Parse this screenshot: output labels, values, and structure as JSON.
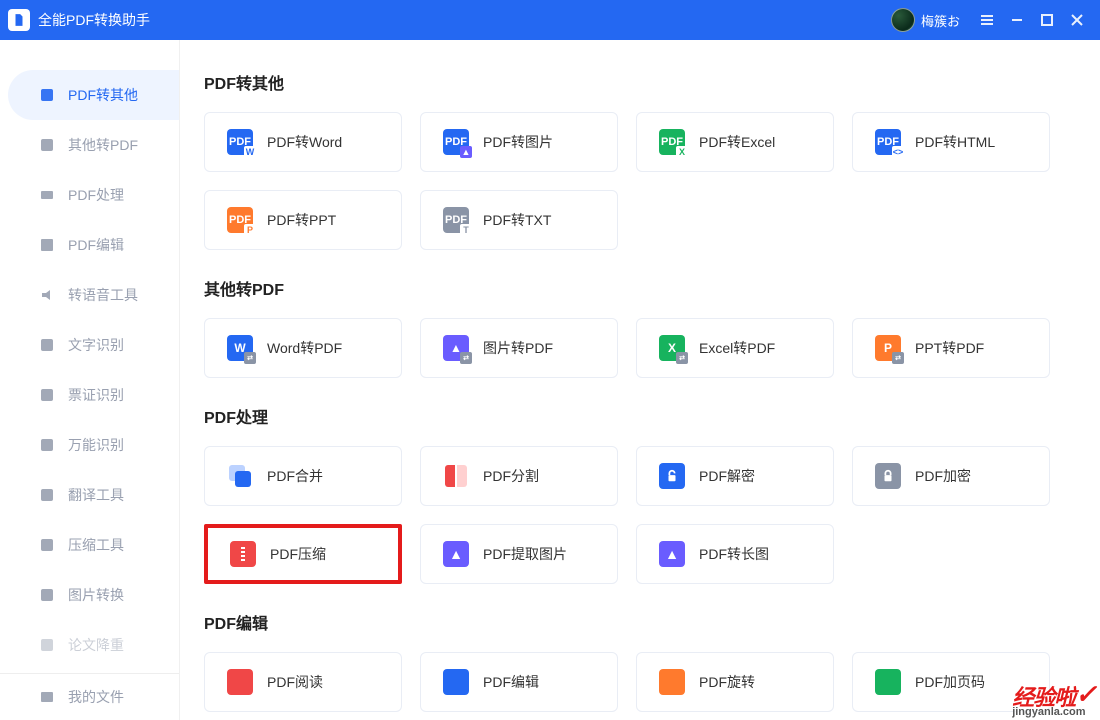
{
  "titlebar": {
    "title": "全能PDF转换助手",
    "username": "梅簇お"
  },
  "sidebar": {
    "items": [
      {
        "label": "PDF转其他"
      },
      {
        "label": "其他转PDF"
      },
      {
        "label": "PDF处理"
      },
      {
        "label": "PDF编辑"
      },
      {
        "label": "转语音工具"
      },
      {
        "label": "文字识别"
      },
      {
        "label": "票证识别"
      },
      {
        "label": "万能识别"
      },
      {
        "label": "翻译工具"
      },
      {
        "label": "压缩工具"
      },
      {
        "label": "图片转换"
      },
      {
        "label": "论文降重"
      }
    ],
    "bottom": {
      "label": "我的文件"
    }
  },
  "sections": [
    {
      "title": "PDF转其他",
      "cards": [
        {
          "label": "PDF转Word"
        },
        {
          "label": "PDF转图片"
        },
        {
          "label": "PDF转Excel"
        },
        {
          "label": "PDF转HTML"
        },
        {
          "label": "PDF转PPT"
        },
        {
          "label": "PDF转TXT"
        }
      ]
    },
    {
      "title": "其他转PDF",
      "cards": [
        {
          "label": "Word转PDF"
        },
        {
          "label": "图片转PDF"
        },
        {
          "label": "Excel转PDF"
        },
        {
          "label": "PPT转PDF"
        }
      ]
    },
    {
      "title": "PDF处理",
      "cards": [
        {
          "label": "PDF合并"
        },
        {
          "label": "PDF分割"
        },
        {
          "label": "PDF解密"
        },
        {
          "label": "PDF加密"
        },
        {
          "label": "PDF压缩"
        },
        {
          "label": "PDF提取图片"
        },
        {
          "label": "PDF转长图"
        }
      ]
    },
    {
      "title": "PDF编辑",
      "cards": [
        {
          "label": "PDF阅读"
        },
        {
          "label": "PDF编辑"
        },
        {
          "label": "PDF旋转"
        },
        {
          "label": "PDF加页码"
        }
      ]
    }
  ],
  "watermark": {
    "main": "经验啦",
    "sub": "jingyanla.com"
  },
  "icons": {
    "colors": {
      "blue": "#2468f2",
      "orange": "#ff7a2d",
      "green": "#17b35e",
      "darkblue": "#2b63d9",
      "gray": "#8a94a6",
      "purple": "#6a5cff",
      "red": "#f04747",
      "cyan": "#19b6e0"
    }
  }
}
